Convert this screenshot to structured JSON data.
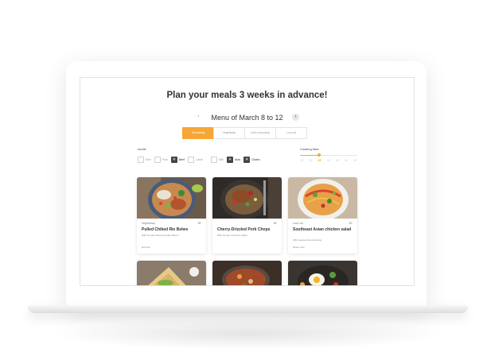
{
  "page": {
    "title": "Plan your meals 3 weeks in advance!",
    "week_label": "Menu of March 8 to 12",
    "prev_icon": "‹",
    "next_icon": "›"
  },
  "tabs": [
    {
      "label": "Everything",
      "active": true
    },
    {
      "label": "Vegetarian",
      "active": false
    },
    {
      "label": "Carb-conscious",
      "active": false
    },
    {
      "label": "Low-cal",
      "active": false
    }
  ],
  "avoid": {
    "label": "Avoid:",
    "options": [
      {
        "label": "Fish",
        "checked": false
      },
      {
        "label": "Pork",
        "checked": false
      },
      {
        "label": "Beef",
        "checked": true
      },
      {
        "label": "Lamb",
        "checked": false
      },
      {
        "label": "Milk",
        "checked": false
      },
      {
        "label": "Nuts",
        "checked": true
      },
      {
        "label": "Gluten",
        "checked": true
      }
    ]
  },
  "cooking_time": {
    "label": "Cooking time:",
    "ticks": [
      "15'",
      "20'",
      "25'",
      "30'",
      "35'",
      "40'",
      "45'"
    ],
    "selected": "25'"
  },
  "cards": [
    {
      "tag": "Vegetarian",
      "time": "30'",
      "name": "Pulled Chiked Rie Bolws",
      "desc": "With Tomato salsa and pak relleno!",
      "foot": "Nut free"
    },
    {
      "tag": "",
      "time": "35'",
      "name": "Cherry-Drizzled Pork Chops",
      "desc": "With tomato couscous salad",
      "foot": ""
    },
    {
      "tag": "Low Cal",
      "time": "30'",
      "name": "Southeast Asian chicken salad",
      "desc": "With sesame-lime dressing",
      "foot": "Gluten free"
    }
  ],
  "colors": {
    "accent": "#f7a735",
    "title_text": "#333333"
  }
}
